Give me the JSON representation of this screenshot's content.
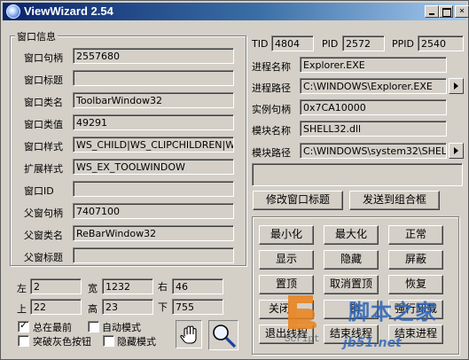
{
  "window": {
    "title": "ViewWizard 2.54"
  },
  "window_info": {
    "group_title": "窗口信息",
    "rows": [
      {
        "label": "窗口句柄",
        "value": "2557680"
      },
      {
        "label": "窗口标题",
        "value": ""
      },
      {
        "label": "窗口类名",
        "value": "ToolbarWindow32"
      },
      {
        "label": "窗口类值",
        "value": "49291"
      },
      {
        "label": "窗口样式",
        "value": "WS_CHILD|WS_CLIPCHILDREN|WS_"
      },
      {
        "label": "扩展样式",
        "value": "WS_EX_TOOLWINDOW"
      },
      {
        "label": "窗口ID",
        "value": ""
      },
      {
        "label": "父窗句柄",
        "value": "7407100"
      },
      {
        "label": "父窗类名",
        "value": "ReBarWindow32"
      },
      {
        "label": "父窗标题",
        "value": ""
      }
    ]
  },
  "rect": {
    "left_label": "左",
    "left": "2",
    "width_label": "宽",
    "width": "1232",
    "right_label": "右",
    "right": "46",
    "top_label": "上",
    "top": "22",
    "height_label": "高",
    "height": "23",
    "bottom_label": "下",
    "bottom": "755"
  },
  "options": {
    "always_on_top": {
      "label": "总在最前",
      "checked": true
    },
    "auto_mode": {
      "label": "自动模式",
      "checked": false
    },
    "break_gray_buttons": {
      "label": "突破灰色按钮",
      "checked": false
    },
    "hide_mode": {
      "label": "隐藏模式",
      "checked": false
    }
  },
  "tools": {
    "hand_icon": "hand-icon",
    "magnifier_icon": "magnifier-icon"
  },
  "process": {
    "tid_label": "TID",
    "tid": "4804",
    "pid_label": "PID",
    "pid": "2572",
    "ppid_label": "PPID",
    "ppid": "2540",
    "name_label": "进程名称",
    "name": "Explorer.EXE",
    "path_label": "进程路径",
    "path": "C:\\WINDOWS\\Explorer.EXE",
    "instance_label": "实例句柄",
    "instance": "0x7CA10000",
    "module_name_label": "模块名称",
    "module_name": "SHELL32.dll",
    "module_path_label": "模块路径",
    "module_path": "C:\\WINDOWS\\system32\\SHELL32",
    "extra": ""
  },
  "actions": {
    "modify_title": "修改窗口标题",
    "send_to_combo": "发送到组合框",
    "minimize": "最小化",
    "maximize": "最大化",
    "normal": "正常",
    "show": "显示",
    "hide": "隐藏",
    "disable": "屏蔽",
    "topmost": "置顶",
    "untopmost": "取消置顶",
    "restore": "恢复",
    "close_window": "关闭",
    "destroy": "销",
    "unload_process": "强行卸载",
    "exit_thread": "退出线程",
    "end_thread": "结束线程",
    "end_process": "结束进程"
  },
  "watermark": {
    "brand": "脚本之家",
    "site": "jb51.net",
    "tag": "Script"
  },
  "colors": {
    "titlebar_start": "#0a246a",
    "titlebar_end": "#a6caf0",
    "watermark_orange": "#e8831f",
    "watermark_blue": "#2a63b8"
  }
}
